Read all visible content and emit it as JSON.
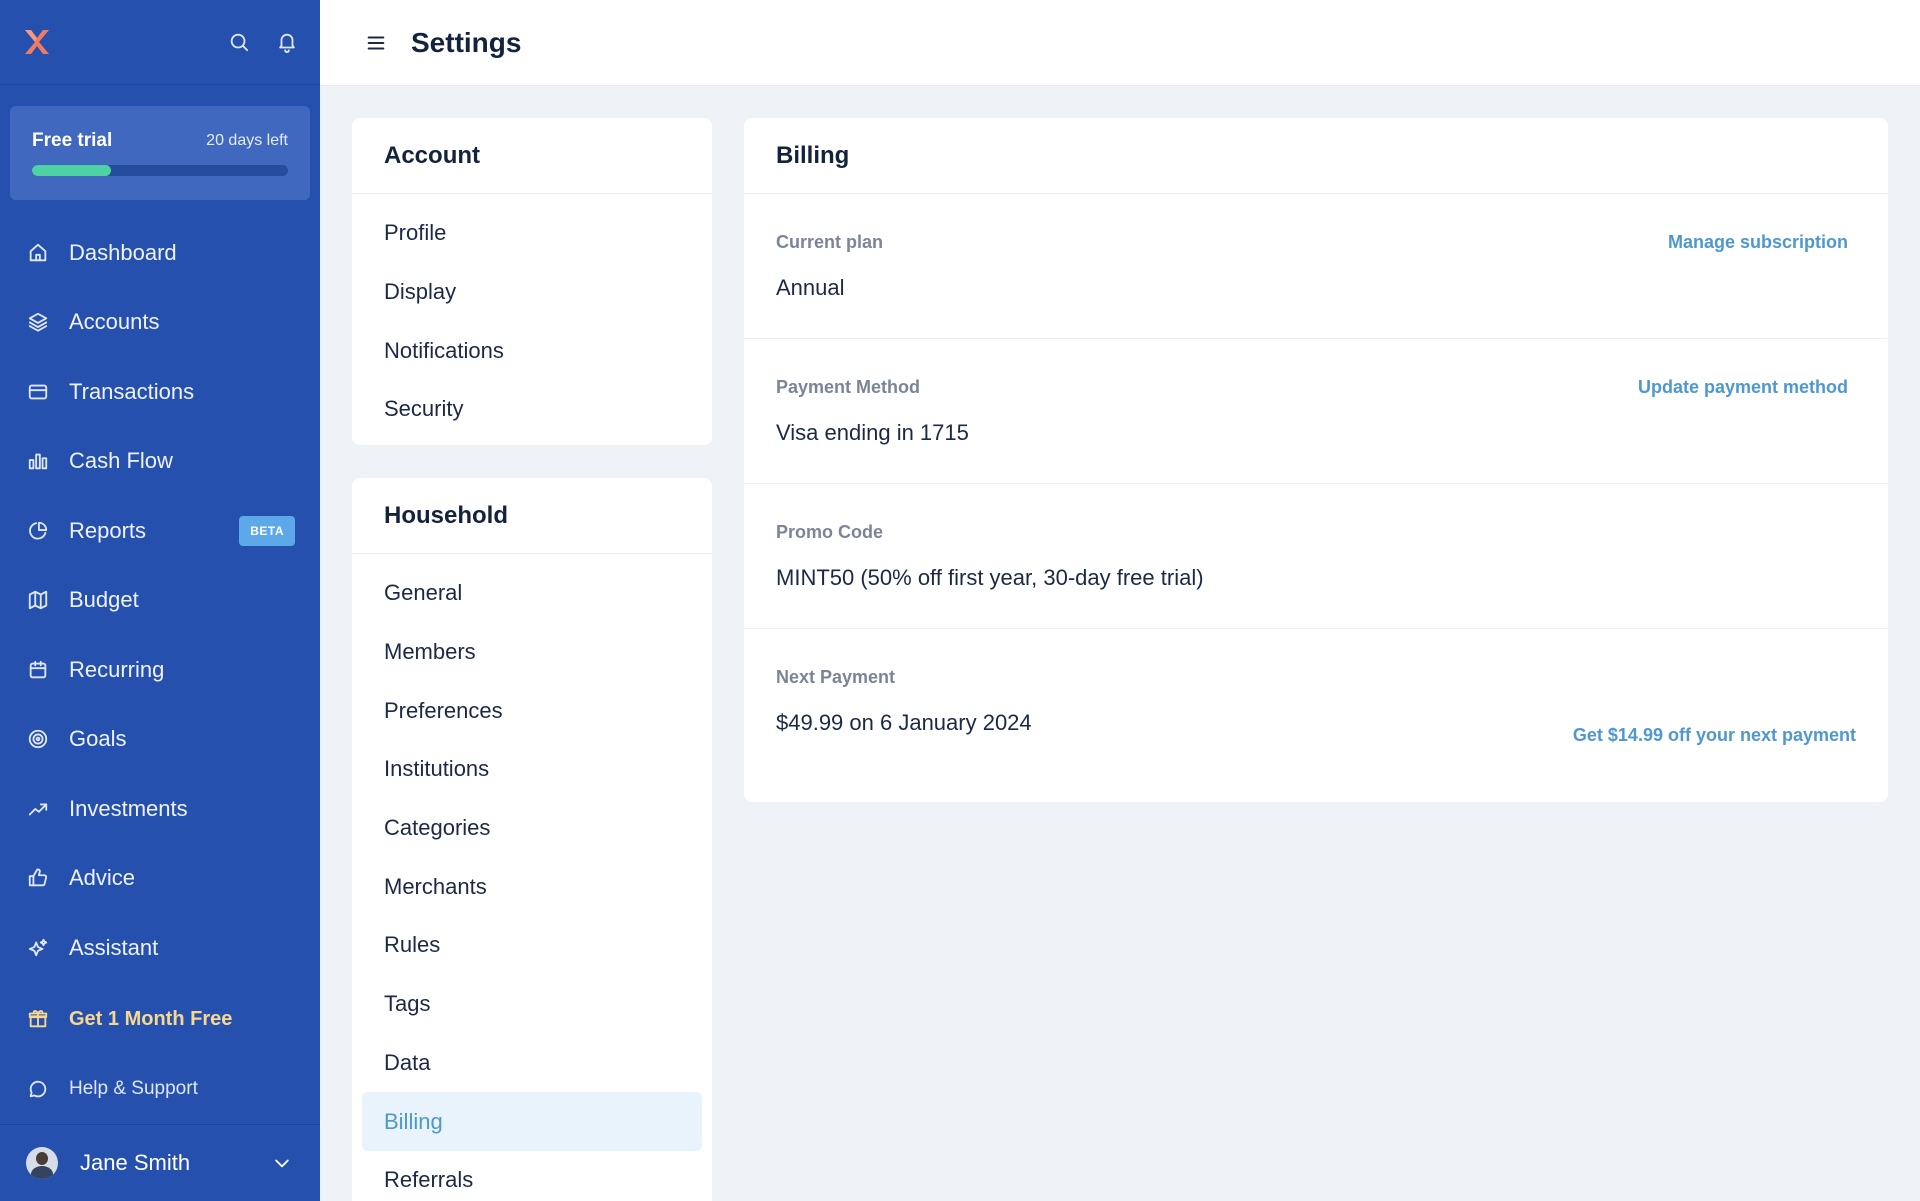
{
  "header": {
    "title": "Settings"
  },
  "trial": {
    "label": "Free trial",
    "days_left": "20 days left",
    "progress_percent": 31
  },
  "sidebar": {
    "items": [
      {
        "label": "Dashboard",
        "icon": "home-icon"
      },
      {
        "label": "Accounts",
        "icon": "layers-icon"
      },
      {
        "label": "Transactions",
        "icon": "credit-card-icon"
      },
      {
        "label": "Cash Flow",
        "icon": "bar-chart-icon"
      },
      {
        "label": "Reports",
        "icon": "pie-chart-icon",
        "badge": "BETA"
      },
      {
        "label": "Budget",
        "icon": "map-icon"
      },
      {
        "label": "Recurring",
        "icon": "calendar-icon"
      },
      {
        "label": "Goals",
        "icon": "target-icon"
      },
      {
        "label": "Investments",
        "icon": "trending-up-icon"
      },
      {
        "label": "Advice",
        "icon": "thumbs-up-icon"
      },
      {
        "label": "Assistant",
        "icon": "sparkles-icon"
      }
    ],
    "promo": "Get 1 Month Free",
    "help": "Help & Support",
    "user": "Jane Smith"
  },
  "account_menu": {
    "title": "Account",
    "items": [
      "Profile",
      "Display",
      "Notifications",
      "Security"
    ]
  },
  "household_menu": {
    "title": "Household",
    "items": [
      "General",
      "Members",
      "Preferences",
      "Institutions",
      "Categories",
      "Merchants",
      "Rules",
      "Tags",
      "Data",
      "Billing",
      "Referrals"
    ],
    "active": "Billing"
  },
  "billing": {
    "title": "Billing",
    "rows": [
      {
        "label": "Current plan",
        "value": "Annual",
        "link": "Manage subscription"
      },
      {
        "label": "Payment Method",
        "value": "Visa ending in 1715",
        "link": "Update payment method"
      },
      {
        "label": "Promo Code",
        "value": "MINT50 (50% off first year, 30-day free trial)"
      },
      {
        "label": "Next Payment",
        "value": "$49.99 on 6 January 2024",
        "link": "Get $14.99 off your next payment"
      }
    ]
  },
  "colors": {
    "sidebar": "#2650ad",
    "accent_link": "#4e98cf",
    "promo": "#f8d88e",
    "progress": "#4fd2a3"
  }
}
